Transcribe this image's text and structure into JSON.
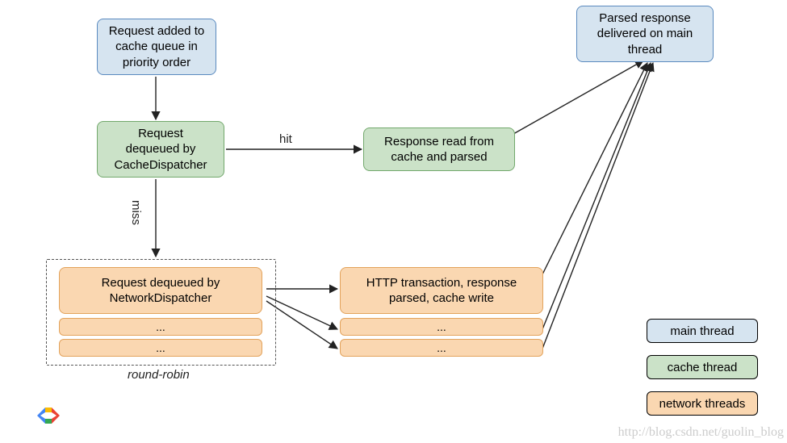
{
  "nodes": {
    "request_added": "Request added to\ncache queue in\npriority order",
    "request_dequeued_cache": "Request\ndequeued by\nCacheDispatcher",
    "response_read": "Response read from\ncache and parsed",
    "parsed_response": "Parsed response\ndelivered on main\nthread",
    "request_dequeued_net": "Request dequeued by\nNetworkDispatcher",
    "http_tx": "HTTP transaction, response\nparsed, cache write",
    "ellipsis": "..."
  },
  "labels": {
    "hit": "hit",
    "miss": "miss",
    "round_robin": "round-robin"
  },
  "legend": {
    "main": "main thread",
    "cache": "cache thread",
    "network": "network threads"
  },
  "watermark": "http://blog.csdn.net/guolin_blog",
  "chart_data": {
    "type": "flow",
    "nodes": [
      {
        "id": "A",
        "label": "Request added to cache queue in priority order",
        "thread": "main"
      },
      {
        "id": "B",
        "label": "Request dequeued by CacheDispatcher",
        "thread": "cache"
      },
      {
        "id": "C",
        "label": "Response read from cache and parsed",
        "thread": "cache"
      },
      {
        "id": "D",
        "label": "Parsed response delivered on main thread",
        "thread": "main"
      },
      {
        "id": "E",
        "label": "Request dequeued by NetworkDispatcher (round-robin pool)",
        "thread": "network"
      },
      {
        "id": "F",
        "label": "HTTP transaction, response parsed, cache write (pool)",
        "thread": "network"
      }
    ],
    "edges": [
      {
        "from": "A",
        "to": "B"
      },
      {
        "from": "B",
        "to": "C",
        "label": "hit"
      },
      {
        "from": "C",
        "to": "D"
      },
      {
        "from": "B",
        "to": "E",
        "label": "miss"
      },
      {
        "from": "E",
        "to": "F"
      },
      {
        "from": "F",
        "to": "D"
      }
    ],
    "legend": [
      {
        "color": "#d6e4f0",
        "label": "main thread"
      },
      {
        "color": "#cbe2c8",
        "label": "cache thread"
      },
      {
        "color": "#fad7b1",
        "label": "network threads"
      }
    ]
  }
}
